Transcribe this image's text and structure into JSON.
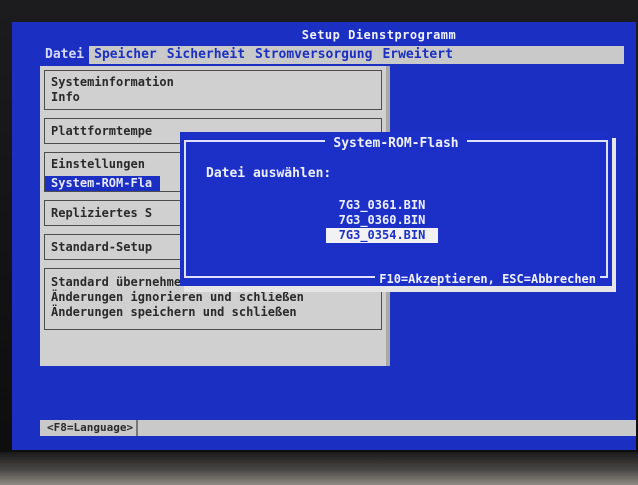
{
  "screen_title": "Setup Dienstprogramm",
  "menu": [
    "Datei",
    "Speicher",
    "Sicherheit",
    "Stromversorgung",
    "Erweitert"
  ],
  "panel": {
    "box1": [
      "Systeminformation",
      "Info"
    ],
    "box2": [
      "Plattformtempe"
    ],
    "box3": [
      "Einstellungen",
      "System-ROM-Fla"
    ],
    "box4": [
      "Repliziertes S"
    ],
    "box5": [
      "Standard-Setup"
    ],
    "box6": [
      "Standard übernehmen und schließen",
      "Änderungen ignorieren und schließen",
      "Änderungen speichern und schließen"
    ]
  },
  "dialog": {
    "title": "System-ROM-Flash",
    "prompt": "Datei auswählen:",
    "files": [
      "7G3_0361.BIN",
      "7G3_0360.BIN",
      "7G3_0354.BIN"
    ],
    "selected_file": "7G3_0354.BIN",
    "hint": "F10=Akzeptieren, ESC=Abbrechen"
  },
  "statusbar": {
    "language": "<F8=Language>"
  },
  "colors": {
    "bios_blue": "#1b2fc2",
    "menu_gray": "#c9c9c9",
    "text_light": "#eef0ff"
  }
}
